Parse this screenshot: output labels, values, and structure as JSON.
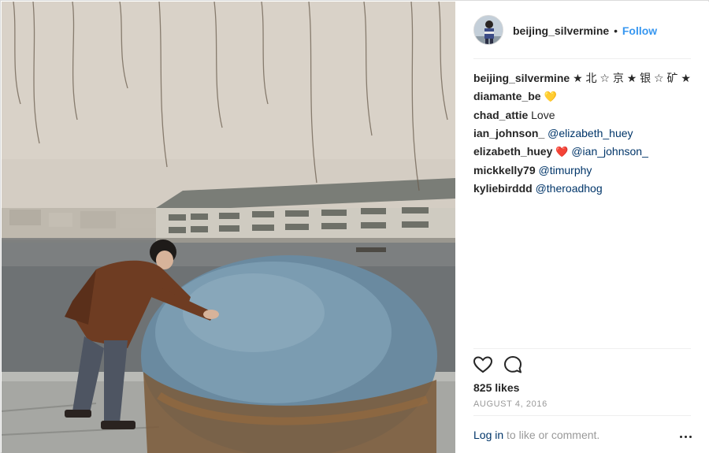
{
  "post": {
    "username": "beijing_silvermine",
    "separator": "•",
    "follow_label": "Follow",
    "avatar_icon": "profile-avatar",
    "photo_icon": "vintage-photo-man-pushing-stone-sphere"
  },
  "caption": {
    "user": "beijing_silvermine",
    "text": "★ 北 ☆ 京 ★ 银 ☆ 矿 ★"
  },
  "comments": [
    {
      "user": "diamante_be",
      "text": "",
      "emoji": "💛"
    },
    {
      "user": "chad_attie",
      "text": "Love"
    },
    {
      "user": "ian_johnson_",
      "mention": "@elizabeth_huey"
    },
    {
      "user": "elizabeth_huey",
      "emoji": "❤️",
      "mention": "@ian_johnson_"
    },
    {
      "user": "mickkelly79",
      "mention": "@timurphy"
    },
    {
      "user": "kyliebirddd",
      "mention": "@theroadhog"
    }
  ],
  "actions": {
    "like_icon": "heart-outline-icon",
    "comment_icon": "comment-bubble-icon"
  },
  "likes_text": "825 likes",
  "date_text": "AUGUST 4, 2016",
  "login": {
    "link": "Log in",
    "text": "to like or comment."
  },
  "colors": {
    "accent": "#3897f0",
    "link_dark": "#003569",
    "muted": "#999999",
    "text": "#262626"
  }
}
